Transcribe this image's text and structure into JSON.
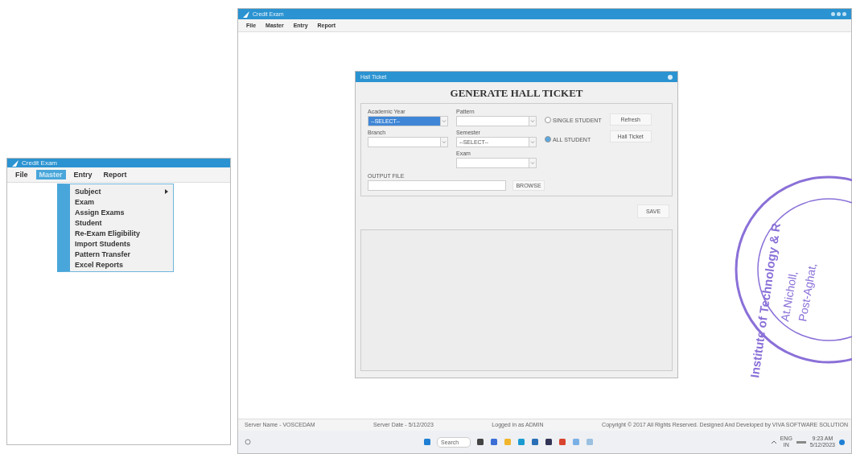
{
  "left_window": {
    "title": "Credit Exam",
    "menu": [
      {
        "label": "File",
        "selected": false
      },
      {
        "label": "Master",
        "selected": true
      },
      {
        "label": "Entry",
        "selected": false
      },
      {
        "label": "Report",
        "selected": false
      }
    ],
    "dropdown": [
      {
        "label": "Subject",
        "submenu": true
      },
      {
        "label": "Exam",
        "submenu": false
      },
      {
        "label": "Assign Exams",
        "submenu": false
      },
      {
        "label": "Student",
        "submenu": false
      },
      {
        "label": "Re-Exam Eligibility",
        "submenu": false
      },
      {
        "label": "Import Students",
        "submenu": false
      },
      {
        "label": "Pattern Transfer",
        "submenu": false
      },
      {
        "label": "Excel Reports",
        "submenu": false
      }
    ]
  },
  "main_window": {
    "title": "Credit Exam",
    "menu": [
      "File",
      "Master",
      "Entry",
      "Report"
    ]
  },
  "dialog": {
    "title": "Hall Ticket",
    "heading": "GENERATE HALL TICKET",
    "columns": [
      [
        {
          "label": "Academic Year",
          "value": "--SELECT--",
          "highlighted": true
        },
        {
          "label": "Branch",
          "highlighted": false
        }
      ],
      [
        {
          "label": "Pattern",
          "highlighted": false
        },
        {
          "label": "Semester",
          "value": "--SELECT--",
          "highlighted": false
        },
        {
          "label": "Exam",
          "highlighted": false
        }
      ]
    ],
    "radios": [
      {
        "label": "SINGLE STUDENT",
        "selected": false
      },
      {
        "label": "ALL STUDENT",
        "selected": true
      }
    ],
    "buttons": [
      "Refresh",
      "Hall Ticket"
    ],
    "output_label": "OUTPUT FILE",
    "browse": "BROWSE",
    "save": "SAVE"
  },
  "status_bar": [
    "Server Name - VOSCEDAM",
    "Server Date - 5/12/2023",
    "Logged in as ADMIN",
    "Copyright © 2017 All Rights Reserved. Designed And Developed by VIVA SOFTWARE SOLUTION"
  ],
  "taskbar": {
    "search": "Search",
    "language": "ENG",
    "region": "IN",
    "time": "9:23 AM",
    "date": "5/12/2023"
  },
  "stamp": {
    "ring_text": "Institute of Technology & R",
    "lines": [
      "At.Nicholl,",
      "Post-Aghat,"
    ]
  }
}
